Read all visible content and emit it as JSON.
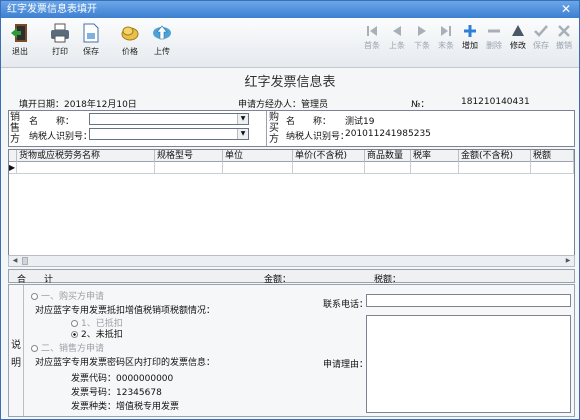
{
  "window": {
    "title": "红字发票信息表填开",
    "close_glyph": "✕"
  },
  "toolbar": {
    "left": [
      {
        "label": "退出",
        "icon": "exit-icon"
      },
      {
        "label": "打印",
        "icon": "print-icon"
      },
      {
        "label": "保存",
        "icon": "save-icon"
      },
      {
        "label": "价格",
        "icon": "price-icon"
      },
      {
        "label": "上传",
        "icon": "upload-icon"
      }
    ],
    "right": [
      {
        "label": "首条",
        "icon": "first-record-icon",
        "enabled": false
      },
      {
        "label": "上条",
        "icon": "prev-record-icon",
        "enabled": false
      },
      {
        "label": "下条",
        "icon": "next-record-icon",
        "enabled": false
      },
      {
        "label": "末条",
        "icon": "last-record-icon",
        "enabled": false
      },
      {
        "label": "增加",
        "icon": "add-icon",
        "enabled": true
      },
      {
        "label": "删除",
        "icon": "delete-icon",
        "enabled": false
      },
      {
        "label": "修改",
        "icon": "edit-icon",
        "enabled": true
      },
      {
        "label": "保存",
        "icon": "save-check-icon",
        "enabled": false
      },
      {
        "label": "撤销",
        "icon": "undo-icon",
        "enabled": false
      }
    ]
  },
  "form": {
    "title": "红字发票信息表",
    "fill_date": "填开日期：2018年12月10日",
    "applicant": "申请方经办人：管理员",
    "no_label": "№：",
    "no_value": "181210140431"
  },
  "seller": {
    "side_label": "销售方",
    "name_label": "名　　称：",
    "name_value": "",
    "taxid_label": "纳税人识别号：",
    "taxid_value": ""
  },
  "buyer": {
    "side_label": "购买方",
    "name_label": "名　　称：",
    "name_value": "测试19",
    "taxid_label": "纳税人识别号：",
    "taxid_value": "201011241985235"
  },
  "grid": {
    "columns": [
      "货物或应税劳务名称",
      "规格型号",
      "单位",
      "单价(不含税)",
      "商品数量",
      "税率",
      "金额(不含税)",
      "税额"
    ],
    "row_indicator": "▶"
  },
  "totals": {
    "sum_label": "合　　计",
    "amount_label": "金额：",
    "tax_label": "税额："
  },
  "bottom": {
    "side_label": "说明",
    "opt1": "一、购买方申请",
    "question": "对应蓝字专用发票抵扣增值税销项税额情况：",
    "opt1a": "1、已抵扣",
    "opt1b": "2、未抵扣",
    "opt2": "二、销售方申请",
    "opt2_desc": "对应蓝字专用发票密码区内打印的发票信息：",
    "invoice_code": "发票代码：0000000000",
    "invoice_number": "发票号码：12345678",
    "invoice_type": "发票种类：增值税专用发票",
    "phone_label": "联系电话：",
    "phone_value": "",
    "reason_label": "申请理由："
  }
}
